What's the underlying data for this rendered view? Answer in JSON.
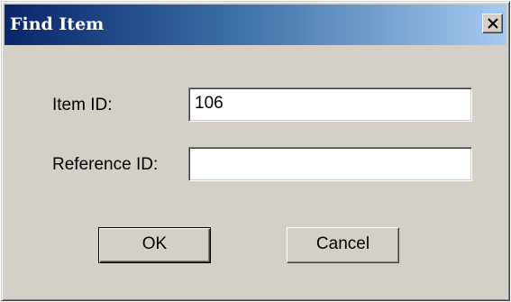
{
  "dialog": {
    "title": "Find Item",
    "close_icon": "close-icon"
  },
  "fields": {
    "item_id_label": "Item ID:",
    "item_id_value": "106",
    "reference_id_label": "Reference ID:",
    "reference_id_value": ""
  },
  "buttons": {
    "ok_label": "OK",
    "cancel_label": "Cancel"
  },
  "colors": {
    "title_gradient_start": "#0a246a",
    "title_gradient_end": "#a6caf0",
    "dialog_background": "#d4d0c8"
  }
}
